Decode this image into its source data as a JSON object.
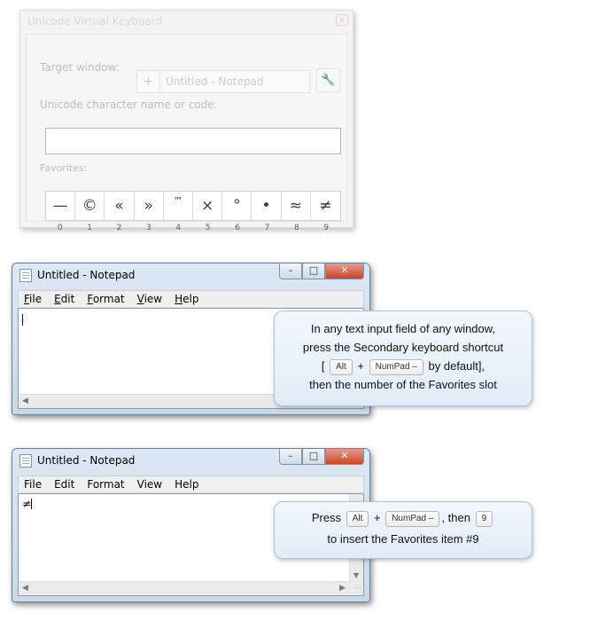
{
  "uvk": {
    "title": "Unicode Virtual Keyboard",
    "close": "x",
    "target_label": "Target window:",
    "target_value": "Untitled - Notepad",
    "target_icon": "crosshair-icon",
    "wrench_icon": "wrench-icon",
    "name_label": "Unicode character name or code:",
    "name_value": "",
    "favorites_label": "Favorites:",
    "favorites": [
      "—",
      "©",
      "«",
      "»",
      "™",
      "×",
      "°",
      "•",
      "≈",
      "≠"
    ],
    "favorite_numbers": [
      "0",
      "1",
      "2",
      "3",
      "4",
      "5",
      "6",
      "7",
      "8",
      "9"
    ]
  },
  "notepad1": {
    "title": "Untitled - Notepad",
    "menu": [
      {
        "acc": "F",
        "rest": "ile"
      },
      {
        "acc": "E",
        "rest": "dit"
      },
      {
        "acc": "F",
        "rest": "ormat",
        "acc_index": 0
      },
      {
        "acc": "V",
        "rest": "iew"
      },
      {
        "acc": "H",
        "rest": "elp"
      }
    ],
    "content": ""
  },
  "notepad2": {
    "title": "Untitled - Notepad",
    "menu": [
      "File",
      "Edit",
      "Format",
      "View",
      "Help"
    ],
    "content": "≠"
  },
  "callout1": {
    "line1": "In any text input field of any window,",
    "line2": "press the Secondary keyboard shortcut",
    "open_bracket": "[",
    "key_alt": "Alt",
    "plus": "+",
    "key_numpad": "NumPad –",
    "by_default": "by default],",
    "line4": "then the number of the Favorites slot"
  },
  "callout2": {
    "press": "Press",
    "key_alt": "Alt",
    "plus": "+",
    "key_numpad": "NumPad –",
    "then": ", then",
    "key_9": "9",
    "line2": "to insert the Favorites item #9"
  }
}
